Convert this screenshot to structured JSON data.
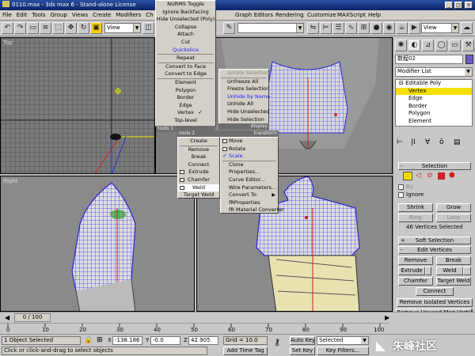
{
  "title": "0110.max - 3ds max 6 - Stand-alone License",
  "menubar": [
    "File",
    "Edit",
    "Tools",
    "Group",
    "Views",
    "Create",
    "Modifiers",
    "Ch",
    "Graph Editors",
    "Rendering",
    "Customize",
    "MAXScript",
    "Help"
  ],
  "toolbar": {
    "view_left": "View",
    "view_right": "View"
  },
  "viewports": {
    "top": "Top",
    "right": "Right",
    "persp": "Perspective"
  },
  "quad_menus": {
    "top_left": {
      "items": [
        "NURMS Toggle",
        "Ignore Backfacing",
        "Hide Unselected (Poly)",
        "Collapse",
        "Attach",
        "Cut",
        "Quickslice",
        "Repeat",
        "Convert to Face",
        "Convert to Edge",
        "Element",
        "Polygon",
        "Border",
        "Edge",
        "Vertex",
        "Top-level"
      ],
      "checked": "Vertex",
      "title_left": "tools 1",
      "title_right": ""
    },
    "top_right": {
      "items": [
        "Isolate Selection",
        "Unfreeze All",
        "Freeze Selection",
        "Unhide by Name",
        "Unhide All",
        "Hide Unselected",
        "Hide Selection"
      ],
      "title_left": "",
      "title_right": "display"
    },
    "bottom_left": {
      "items": [
        "Create",
        "Remove",
        "Break",
        "Connect",
        "Extrude",
        "Chamfer",
        "Weld",
        "Target Weld"
      ],
      "title_left": "tools 2",
      "title_right": ""
    },
    "bottom_right": {
      "items": [
        "Move",
        "Rotate",
        "Scale",
        "Clone",
        "Properties...",
        "Curve Editor...",
        "Wire Parameters...",
        "Convert To:",
        "fRProperties",
        "fR Material Converter"
      ],
      "checked": "Scale",
      "title_left": "",
      "title_right": "transform"
    }
  },
  "cmd_panel": {
    "object_name": "数程02",
    "modifier_list": "Modifier List",
    "stack": [
      "Editable Poly",
      "Vertex",
      "Edge",
      "Border",
      "Polygon",
      "Element"
    ],
    "stack_selected": "Vertex",
    "selection_rollout": "Selection",
    "by_label": "By",
    "ignore_label": "Ignore",
    "shrink": "Shrink",
    "grow": "Grow",
    "ring": "Ring",
    "loop": "Loop",
    "sel_status": "46 Vertices Selected",
    "soft_selection": "Soft Selection",
    "edit_vertices": "Edit Vertices",
    "remove": "Remove",
    "break": "Break",
    "extrude": "Extrude",
    "weld": "Weld",
    "chamfer": "Chamfer",
    "target_weld": "Target Weld",
    "connect": "Connect",
    "remove_isolated": "Remove Isolated Vertices",
    "remove_unused": "Remove Unused Map Vertices"
  },
  "timebar": {
    "frame": "0 / 100",
    "ticks": [
      "0",
      "10",
      "20",
      "30",
      "40",
      "50",
      "60",
      "70",
      "80",
      "90",
      "100"
    ]
  },
  "status": {
    "selected": "1 Object Selected",
    "prompt": "Click or click-and-drag to select objects",
    "x_label": "X",
    "x": "-138.186",
    "y_label": "Y",
    "y": "-0.0",
    "z_label": "Z",
    "z": "42.905",
    "grid": "Grid = 10.0",
    "add_time_tag": "Add Time Tag",
    "auto_key": "Auto Key",
    "set_key": "Set Key",
    "selected_dd": "Selected",
    "key_filters": "Key Filters...",
    "watermark": "朱峰社区"
  }
}
